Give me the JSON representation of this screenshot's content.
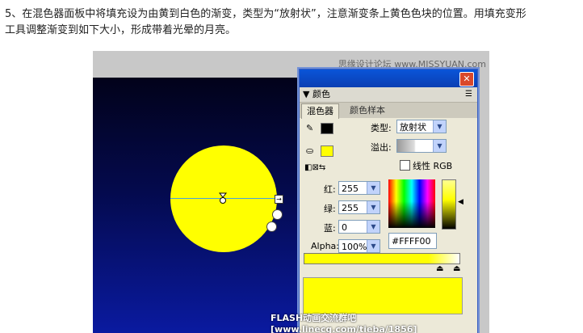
{
  "instruction": {
    "line1": "5、在混色器面板中将填充设为由黄到白色的渐变，类型为“放射状”，注意渐变条上黄色色块的位置。用填充变形",
    "line2": "工具调整渐变到如下大小，形成带着光晕的月亮。"
  },
  "watermark": "思缘设计论坛 www.MISSYUAN.com",
  "panel": {
    "title": "颜色",
    "tabs": [
      "混色器",
      "颜色样本"
    ],
    "type_label": "类型:",
    "type_value": "放射状",
    "overflow_label": "溢出:",
    "linear_rgb_label": "线性 RGB",
    "red_label": "红:",
    "red_value": "255",
    "green_label": "绿:",
    "green_value": "255",
    "blue_label": "蓝:",
    "blue_value": "0",
    "alpha_label": "Alpha:",
    "alpha_value": "100%",
    "hex_value": "#FFFF00",
    "stroke_color": "#000000",
    "fill_color": "#ffff00"
  },
  "credit": "FLASH动画交流群吧 [www.linecg.com/tieba/1856]"
}
